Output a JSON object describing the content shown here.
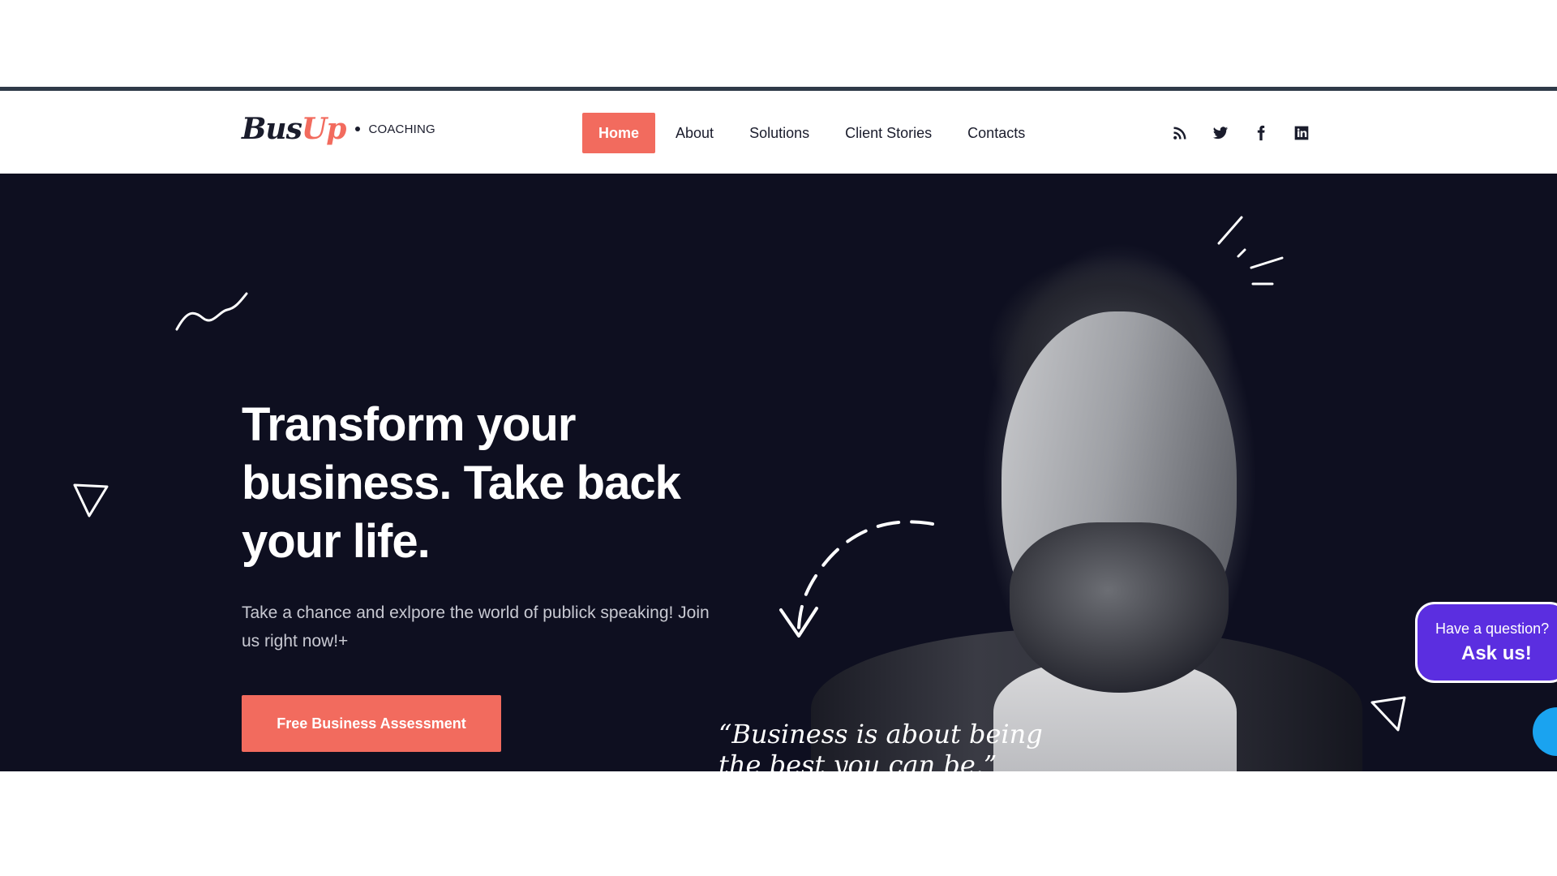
{
  "header": {
    "logo": {
      "bus": "Bus",
      "up": "Up",
      "sub": "COACHING"
    },
    "nav": [
      {
        "label": "Home",
        "active": true
      },
      {
        "label": "About",
        "active": false
      },
      {
        "label": "Solutions",
        "active": false
      },
      {
        "label": "Client Stories",
        "active": false
      },
      {
        "label": "Contacts",
        "active": false
      }
    ],
    "socials": [
      "rss-icon",
      "twitter-icon",
      "facebook-icon",
      "linkedin-icon"
    ]
  },
  "hero": {
    "title": "Transform your business. Take back your life.",
    "subtitle": "Take a chance and exlpore the world of publick speaking! Join us right now!+",
    "cta_label": "Free Business Assessment",
    "quote": "“Business is about being the best you can be.”"
  },
  "chat": {
    "question": "Have a question?",
    "answer": "Ask us!"
  },
  "colors": {
    "accent": "#f26b5e",
    "hero_bg": "#0e0f20",
    "chat": "#5b2ee0",
    "chat_button": "#1aa3f0"
  }
}
